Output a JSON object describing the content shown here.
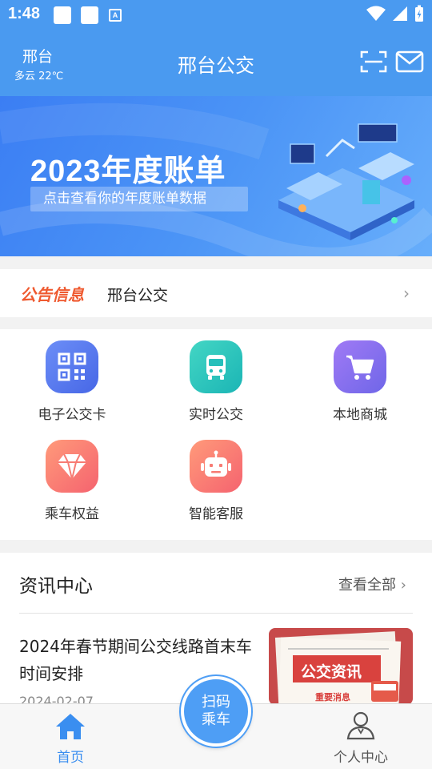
{
  "status_bar": {
    "time": "1:48",
    "notification_icon_label": "A"
  },
  "header": {
    "city": "邢台",
    "weather": "多云 22℃",
    "title": "邢台公交"
  },
  "banner": {
    "title": "2023年度账单",
    "subtitle": "点击查看你的年度账单数据"
  },
  "notice": {
    "tag": "公告信息",
    "text": "邢台公交"
  },
  "services": [
    {
      "label": "电子公交卡",
      "icon": "qr-code-icon"
    },
    {
      "label": "实时公交",
      "icon": "bus-icon"
    },
    {
      "label": "本地商城",
      "icon": "shopping-cart-icon"
    },
    {
      "label": "乘车权益",
      "icon": "diamond-icon"
    },
    {
      "label": "智能客服",
      "icon": "robot-icon"
    }
  ],
  "news": {
    "title": "资讯中心",
    "more": "查看全部",
    "items": [
      {
        "title": "2024年春节期间公交线路首末车时间安排",
        "date": "2024-02-07",
        "thumb_text": "公交资讯",
        "thumb_sub": "重要消息"
      }
    ]
  },
  "bottom_nav": {
    "home": "首页",
    "scan_line1": "扫码",
    "scan_line2": "乘车",
    "profile": "个人中心"
  },
  "colors": {
    "primary": "#4a9af0",
    "notice_tag": "#ef5a30"
  }
}
